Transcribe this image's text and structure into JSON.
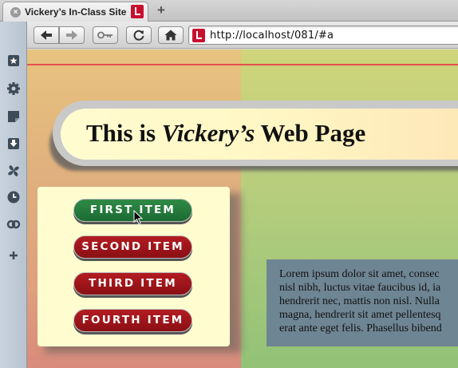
{
  "browser": {
    "tab": {
      "title": "Vickery’s In-Class Site"
    },
    "new_tab_label": "+",
    "address": "http://localhost/081/#a"
  },
  "sidebar": {
    "icons": [
      "bookmark-star-icon",
      "gear-icon",
      "notes-icon",
      "download-icon",
      "fan-icon",
      "clock-icon",
      "link-icon",
      "add-icon"
    ]
  },
  "page": {
    "title_prefix": "This is ",
    "title_name": "Vickery’s",
    "title_suffix": " Web Page",
    "menu": [
      {
        "label": "FIRST ITEM",
        "state": "active"
      },
      {
        "label": "SECOND ITEM",
        "state": "normal"
      },
      {
        "label": "THIRD ITEM",
        "state": "normal"
      },
      {
        "label": "FOURTH ITEM",
        "state": "normal"
      }
    ],
    "lorem_lines": [
      "Lorem ipsum dolor sit amet, consec",
      "nisl nibh, luctus vitae faucibus id, ia",
      "hendrerit nec, mattis non nisl. Nulla",
      "magna, hendrerit sit amet pellentesq",
      "erat ante eget felis. Phasellus bibend"
    ]
  },
  "colors": {
    "active_item": "#1c6b33",
    "item": "#8a0f14",
    "accent_line": "#e4504f"
  }
}
